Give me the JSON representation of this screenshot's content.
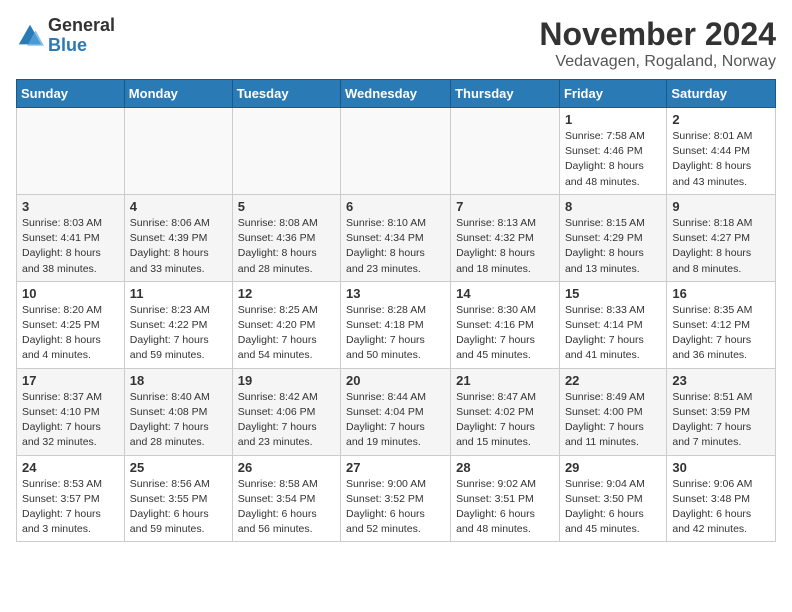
{
  "header": {
    "logo_general": "General",
    "logo_blue": "Blue",
    "month": "November 2024",
    "location": "Vedavagen, Rogaland, Norway"
  },
  "weekdays": [
    "Sunday",
    "Monday",
    "Tuesday",
    "Wednesday",
    "Thursday",
    "Friday",
    "Saturday"
  ],
  "weeks": [
    [
      {
        "day": "",
        "info": ""
      },
      {
        "day": "",
        "info": ""
      },
      {
        "day": "",
        "info": ""
      },
      {
        "day": "",
        "info": ""
      },
      {
        "day": "",
        "info": ""
      },
      {
        "day": "1",
        "info": "Sunrise: 7:58 AM\nSunset: 4:46 PM\nDaylight: 8 hours\nand 48 minutes."
      },
      {
        "day": "2",
        "info": "Sunrise: 8:01 AM\nSunset: 4:44 PM\nDaylight: 8 hours\nand 43 minutes."
      }
    ],
    [
      {
        "day": "3",
        "info": "Sunrise: 8:03 AM\nSunset: 4:41 PM\nDaylight: 8 hours\nand 38 minutes."
      },
      {
        "day": "4",
        "info": "Sunrise: 8:06 AM\nSunset: 4:39 PM\nDaylight: 8 hours\nand 33 minutes."
      },
      {
        "day": "5",
        "info": "Sunrise: 8:08 AM\nSunset: 4:36 PM\nDaylight: 8 hours\nand 28 minutes."
      },
      {
        "day": "6",
        "info": "Sunrise: 8:10 AM\nSunset: 4:34 PM\nDaylight: 8 hours\nand 23 minutes."
      },
      {
        "day": "7",
        "info": "Sunrise: 8:13 AM\nSunset: 4:32 PM\nDaylight: 8 hours\nand 18 minutes."
      },
      {
        "day": "8",
        "info": "Sunrise: 8:15 AM\nSunset: 4:29 PM\nDaylight: 8 hours\nand 13 minutes."
      },
      {
        "day": "9",
        "info": "Sunrise: 8:18 AM\nSunset: 4:27 PM\nDaylight: 8 hours\nand 8 minutes."
      }
    ],
    [
      {
        "day": "10",
        "info": "Sunrise: 8:20 AM\nSunset: 4:25 PM\nDaylight: 8 hours\nand 4 minutes."
      },
      {
        "day": "11",
        "info": "Sunrise: 8:23 AM\nSunset: 4:22 PM\nDaylight: 7 hours\nand 59 minutes."
      },
      {
        "day": "12",
        "info": "Sunrise: 8:25 AM\nSunset: 4:20 PM\nDaylight: 7 hours\nand 54 minutes."
      },
      {
        "day": "13",
        "info": "Sunrise: 8:28 AM\nSunset: 4:18 PM\nDaylight: 7 hours\nand 50 minutes."
      },
      {
        "day": "14",
        "info": "Sunrise: 8:30 AM\nSunset: 4:16 PM\nDaylight: 7 hours\nand 45 minutes."
      },
      {
        "day": "15",
        "info": "Sunrise: 8:33 AM\nSunset: 4:14 PM\nDaylight: 7 hours\nand 41 minutes."
      },
      {
        "day": "16",
        "info": "Sunrise: 8:35 AM\nSunset: 4:12 PM\nDaylight: 7 hours\nand 36 minutes."
      }
    ],
    [
      {
        "day": "17",
        "info": "Sunrise: 8:37 AM\nSunset: 4:10 PM\nDaylight: 7 hours\nand 32 minutes."
      },
      {
        "day": "18",
        "info": "Sunrise: 8:40 AM\nSunset: 4:08 PM\nDaylight: 7 hours\nand 28 minutes."
      },
      {
        "day": "19",
        "info": "Sunrise: 8:42 AM\nSunset: 4:06 PM\nDaylight: 7 hours\nand 23 minutes."
      },
      {
        "day": "20",
        "info": "Sunrise: 8:44 AM\nSunset: 4:04 PM\nDaylight: 7 hours\nand 19 minutes."
      },
      {
        "day": "21",
        "info": "Sunrise: 8:47 AM\nSunset: 4:02 PM\nDaylight: 7 hours\nand 15 minutes."
      },
      {
        "day": "22",
        "info": "Sunrise: 8:49 AM\nSunset: 4:00 PM\nDaylight: 7 hours\nand 11 minutes."
      },
      {
        "day": "23",
        "info": "Sunrise: 8:51 AM\nSunset: 3:59 PM\nDaylight: 7 hours\nand 7 minutes."
      }
    ],
    [
      {
        "day": "24",
        "info": "Sunrise: 8:53 AM\nSunset: 3:57 PM\nDaylight: 7 hours\nand 3 minutes."
      },
      {
        "day": "25",
        "info": "Sunrise: 8:56 AM\nSunset: 3:55 PM\nDaylight: 6 hours\nand 59 minutes."
      },
      {
        "day": "26",
        "info": "Sunrise: 8:58 AM\nSunset: 3:54 PM\nDaylight: 6 hours\nand 56 minutes."
      },
      {
        "day": "27",
        "info": "Sunrise: 9:00 AM\nSunset: 3:52 PM\nDaylight: 6 hours\nand 52 minutes."
      },
      {
        "day": "28",
        "info": "Sunrise: 9:02 AM\nSunset: 3:51 PM\nDaylight: 6 hours\nand 48 minutes."
      },
      {
        "day": "29",
        "info": "Sunrise: 9:04 AM\nSunset: 3:50 PM\nDaylight: 6 hours\nand 45 minutes."
      },
      {
        "day": "30",
        "info": "Sunrise: 9:06 AM\nSunset: 3:48 PM\nDaylight: 6 hours\nand 42 minutes."
      }
    ]
  ]
}
